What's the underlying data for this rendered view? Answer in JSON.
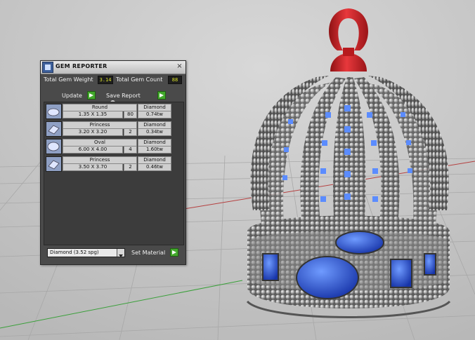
{
  "panel": {
    "title": "GEM REPORTER",
    "close_glyph": "×",
    "total_weight_label": "Total Gem Weight",
    "total_weight_value": "3.14",
    "total_count_label": "Total Gem Count",
    "total_count_value": "88",
    "update_label": "Update",
    "save_report_label": "Save Report",
    "rows": [
      {
        "shape": "Round",
        "size": "1.35 X 1.35",
        "count": "80",
        "stone": "Diamond",
        "weight": "0.74tw",
        "icon": "round-gem-icon"
      },
      {
        "shape": "Princess",
        "size": "3.20 X 3.20",
        "count": "2",
        "stone": "Diamond",
        "weight": "0.34tw",
        "icon": "princess-gem-icon"
      },
      {
        "shape": "Oval",
        "size": "6.00 X 4.00",
        "count": "4",
        "stone": "Diamond",
        "weight": "1.60tw",
        "icon": "oval-gem-icon"
      },
      {
        "shape": "Princess",
        "size": "3.50 X 3.70",
        "count": "2",
        "stone": "Diamond",
        "weight": "0.46tw",
        "icon": "princess-gem-icon"
      }
    ],
    "material_value": "Diamond    (3.52 spg)",
    "set_material_label": "Set Material"
  },
  "colors": {
    "metal": "#9a9a9a",
    "stone_blue": "#2f56d6",
    "bail_red": "#d41f24",
    "button_green": "#43a82c"
  }
}
